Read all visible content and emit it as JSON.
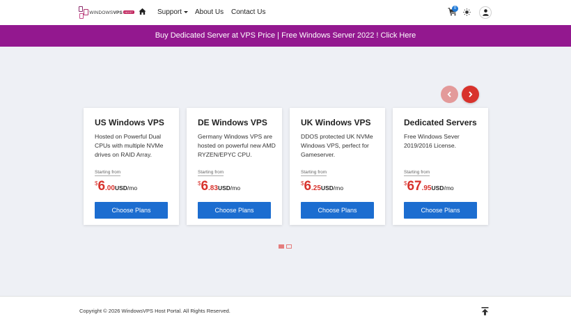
{
  "nav": {
    "logo_text_prefix": "WINDOWS",
    "logo_text_bold": "VPS",
    "logo_badge": "HOST",
    "home_icon": "home-icon",
    "support_label": "Support",
    "about_label": "About Us",
    "contact_label": "Contact Us",
    "cart_icon": "cart-icon",
    "cart_count": "0",
    "theme_icon": "sun-icon",
    "account_icon": "user-icon"
  },
  "promo": {
    "text": "Buy Dedicated Server at VPS Price | Free Windows Server 2022 ! Click Here",
    "color": "#93188f"
  },
  "carousel": {
    "prev_icon": "chevron-left-icon",
    "next_icon": "chevron-right-icon",
    "accent_color": "#d8322c",
    "button_color": "#1c6dd0",
    "active_page": 1,
    "page_count": 2,
    "cards": [
      {
        "title": "US Windows VPS",
        "description": "Hosted on Powerful Dual CPUs with multiple NVMe drives on RAID Array.",
        "from_label": "Starting from",
        "currency": "$",
        "price_int": "6",
        "price_dec": ".00",
        "price_unit": "USD",
        "price_period": "/mo",
        "button": "Choose Plans"
      },
      {
        "title": "DE Windows VPS",
        "description": "Germany Windows VPS are hosted on powerful new AMD RYZEN/EPYC CPU.",
        "from_label": "Starting from",
        "currency": "$",
        "price_int": "6",
        "price_dec": ".83",
        "price_unit": "USD",
        "price_period": "/mo",
        "button": "Choose Plans"
      },
      {
        "title": "UK Windows VPS",
        "description": "DDOS protected UK NVMe Windows VPS, perfect for Gameserver.",
        "from_label": "Starting from",
        "currency": "$",
        "price_int": "6",
        "price_dec": ".25",
        "price_unit": "USD",
        "price_period": "/mo",
        "button": "Choose Plans"
      },
      {
        "title": "Dedicated Servers",
        "description": "Free Windows Sever 2019/2016 License.",
        "from_label": "Starting from",
        "currency": "$",
        "price_int": "67",
        "price_dec": ".95",
        "price_unit": "USD",
        "price_period": "/mo",
        "button": "Choose Plans"
      }
    ]
  },
  "footer": {
    "copyright": "Copyright © 2026 WindowsVPS Host Portal. All Rights Reserved.",
    "to_top_icon": "arrow-up-to-line-icon"
  }
}
